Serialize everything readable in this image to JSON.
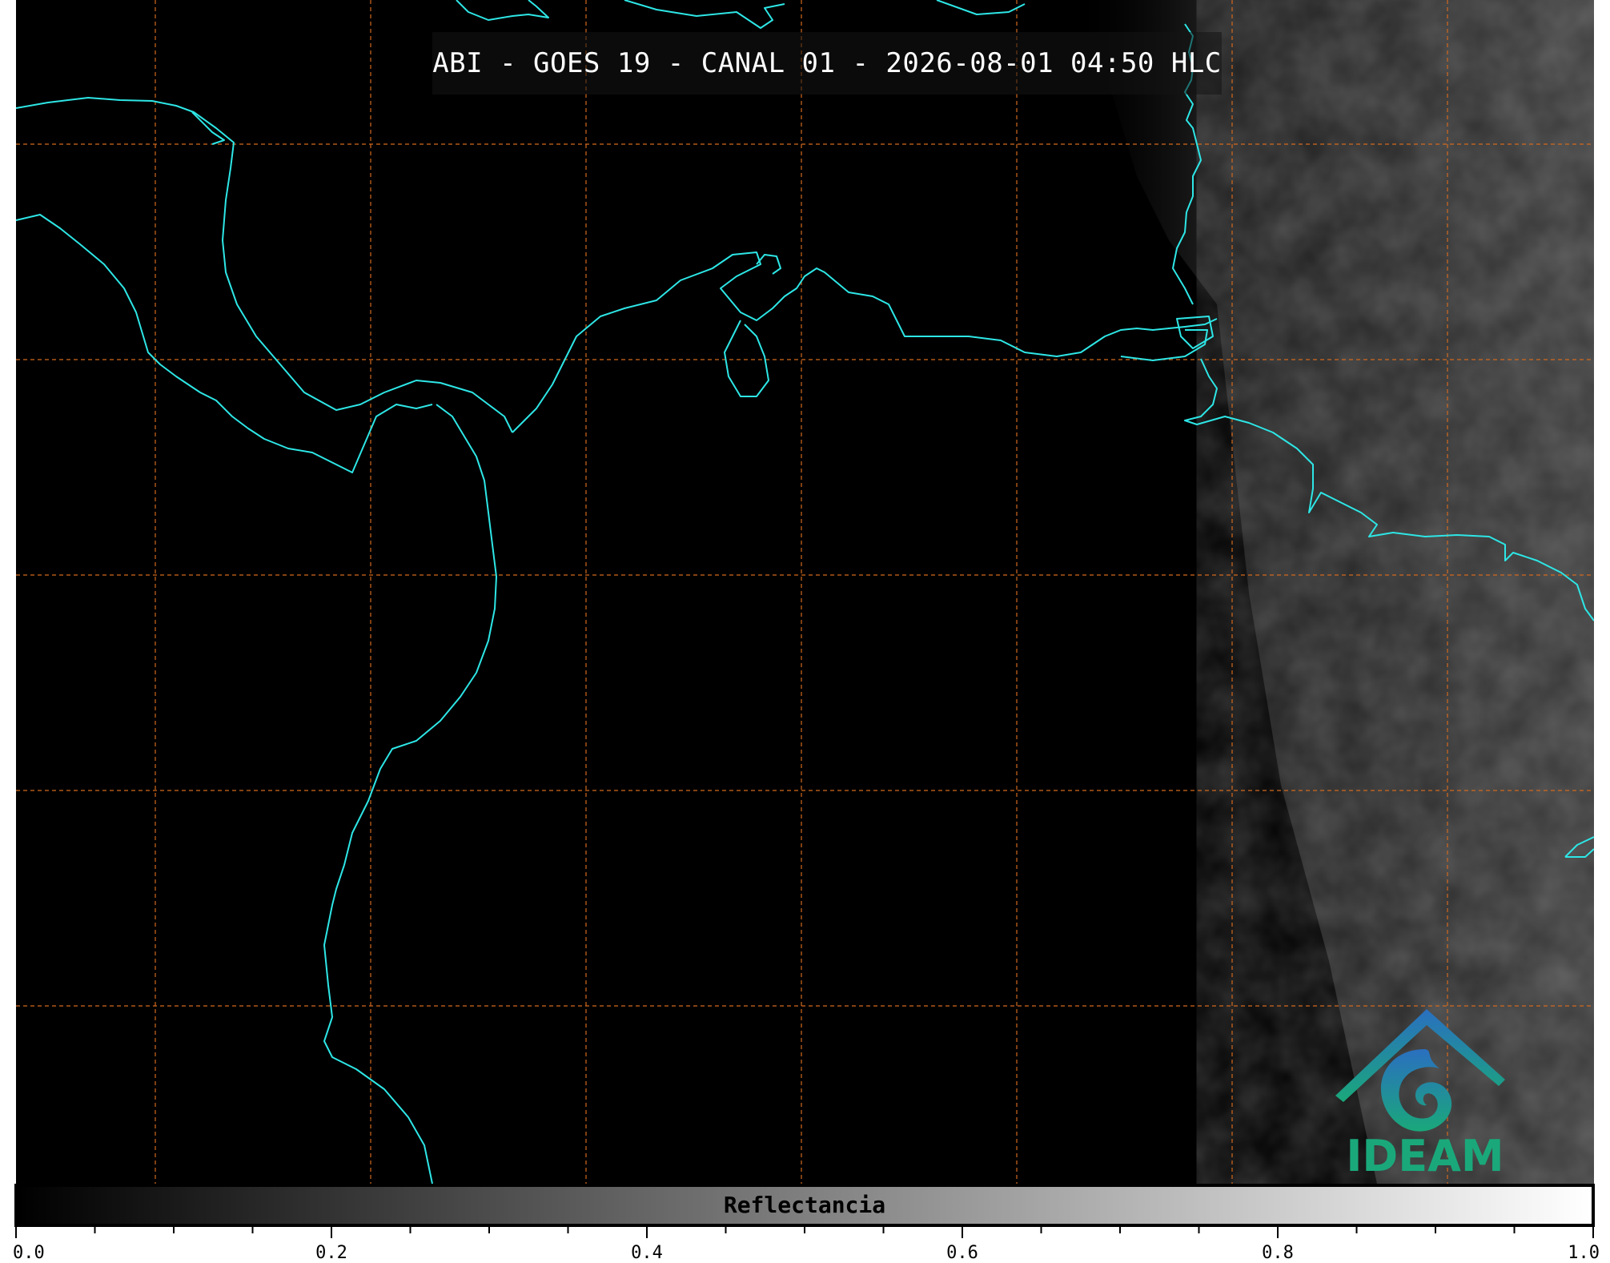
{
  "title": "ABI - GOES 19 - CANAL 01 - 2026-08-01 04:50 HLC",
  "colors": {
    "coastline": "#2ee6e6",
    "gridline": "#d2691e",
    "background": "#000000",
    "logo_blue": "#2a7fc0",
    "logo_green": "#1aa87a"
  },
  "logo": {
    "text": "IDEAM",
    "icon": "ideam-mountain-spiral-logo"
  },
  "colorbar": {
    "label": "Reflectancia",
    "min": 0.0,
    "max": 1.0,
    "colormap": "grayscale black-to-white",
    "tick_labels": [
      "0.0",
      "0.2",
      "0.4",
      "0.6",
      "0.8",
      "1.0"
    ],
    "tick_values": [
      0.0,
      0.2,
      0.4,
      0.6,
      0.8,
      1.0
    ],
    "minor_step": 0.05
  }
}
